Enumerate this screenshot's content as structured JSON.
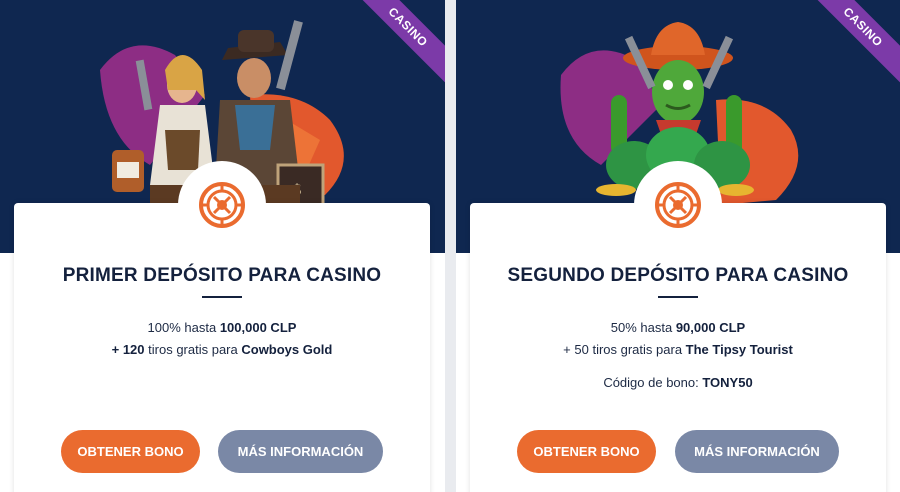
{
  "colors": {
    "hero_bg": "#0f2750",
    "ribbon": "#7c3aa8",
    "primary_button": "#ea6b2f",
    "secondary_button": "#7a88a6",
    "roulette_icon": "#ea6b2f"
  },
  "offers": [
    {
      "ribbon": "CASINO",
      "icon": "roulette-icon",
      "title": "PRIMER DEPÓSITO PARA CASINO",
      "line1_prefix": "100% hasta ",
      "line1_amount": "100,000 CLP",
      "line2_prefix": "+ 120",
      "line2_middle": " tiros gratis para ",
      "line2_game": "Cowboys Gold",
      "primary_button": "OBTENER BONO",
      "secondary_button": "MÁS INFORMACIÓN"
    },
    {
      "ribbon": "CASINO",
      "icon": "roulette-icon",
      "title": "SEGUNDO DEPÓSITO PARA CASINO",
      "line1_prefix": "50% hasta ",
      "line1_amount": "90,000 CLP",
      "line2_prefix": "+ 50",
      "line2_middle": " tiros gratis para ",
      "line2_game": "The Tipsy Tourist",
      "code_label": "Código de bono: ",
      "code_value": "TONY50",
      "primary_button": "OBTENER BONO",
      "secondary_button": "MÁS INFORMACIÓN"
    }
  ]
}
